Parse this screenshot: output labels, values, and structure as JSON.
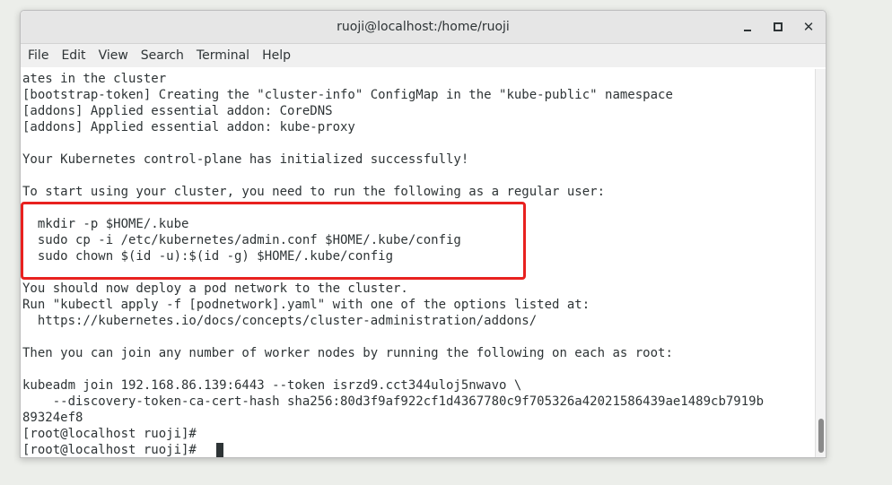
{
  "window": {
    "title": "ruoji@localhost:/home/ruoji"
  },
  "menu": [
    {
      "label": "File"
    },
    {
      "label": "Edit"
    },
    {
      "label": "View"
    },
    {
      "label": "Search"
    },
    {
      "label": "Terminal"
    },
    {
      "label": "Help"
    }
  ],
  "terminal": {
    "lines": [
      "ates in the cluster",
      "[bootstrap-token] Creating the \"cluster-info\" ConfigMap in the \"kube-public\" namespace",
      "[addons] Applied essential addon: CoreDNS",
      "[addons] Applied essential addon: kube-proxy",
      "",
      "Your Kubernetes control-plane has initialized successfully!",
      "",
      "To start using your cluster, you need to run the following as a regular user:",
      "",
      "  mkdir -p $HOME/.kube",
      "  sudo cp -i /etc/kubernetes/admin.conf $HOME/.kube/config",
      "  sudo chown $(id -u):$(id -g) $HOME/.kube/config",
      "",
      "You should now deploy a pod network to the cluster.",
      "Run \"kubectl apply -f [podnetwork].yaml\" with one of the options listed at:",
      "  https://kubernetes.io/docs/concepts/cluster-administration/addons/",
      "",
      "Then you can join any number of worker nodes by running the following on each as root:",
      "",
      "kubeadm join 192.168.86.139:6443 --token isrzd9.cct344uloj5nwavo \\",
      "    --discovery-token-ca-cert-hash sha256:80d3f9af922cf1d4367780c9f705326a42021586439ae1489cb7919b",
      "89324ef8",
      "[root@localhost ruoji]#",
      "[root@localhost ruoji]# "
    ]
  },
  "colors": {
    "highlight": "#e8211f",
    "text": "#2e3436"
  }
}
